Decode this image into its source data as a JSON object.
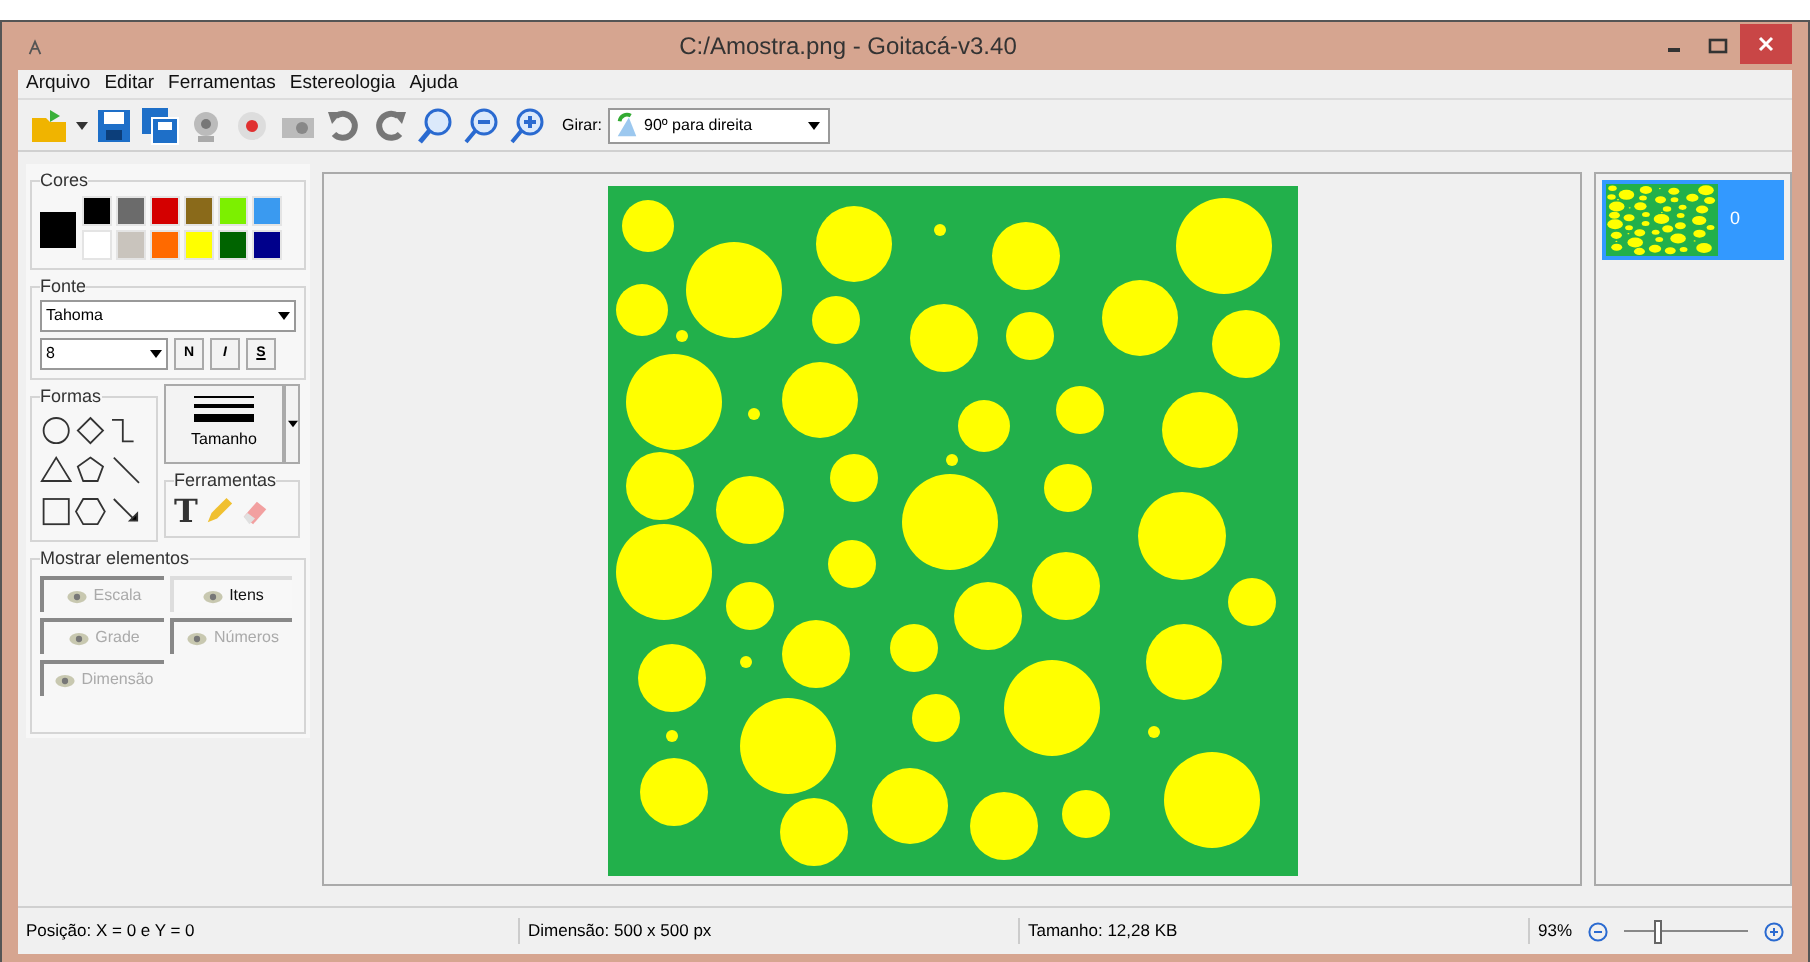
{
  "window": {
    "title": "C:/Amostra.png - Goitacá-v3.40"
  },
  "menu": [
    "Arquivo",
    "Editar",
    "Ferramentas",
    "Estereologia",
    "Ajuda"
  ],
  "toolbar": {
    "rotate_label": "Girar:",
    "rotate_value": "90º para direita"
  },
  "colors": {
    "title": "Cores",
    "current": {
      "color": "#000000"
    },
    "palette": [
      {
        "color": "#000000"
      },
      {
        "color": "#6b6b6b"
      },
      {
        "color": "#d40000"
      },
      {
        "color": "#8a6a1a"
      },
      {
        "color": "#7cf000"
      },
      {
        "color": "#3a9af0"
      },
      {
        "color": "#ffffff"
      },
      {
        "color": "#c9c4bd"
      },
      {
        "color": "#ff6a00"
      },
      {
        "color": "#ffff00"
      },
      {
        "color": "#006400"
      },
      {
        "color": "#00008b"
      }
    ]
  },
  "font": {
    "title": "Fonte",
    "family": "Tahoma",
    "size": "8",
    "styles": [
      "N",
      "I",
      "S"
    ]
  },
  "shapes": {
    "title": "Formas",
    "size_label": "Tamanho"
  },
  "tools": {
    "title": "Ferramentas",
    "items": [
      "T"
    ]
  },
  "show": {
    "title": "Mostrar elementos",
    "items": [
      {
        "label": "Escala",
        "on": false
      },
      {
        "label": "Itens",
        "on": true
      },
      {
        "label": "Grade",
        "on": false
      },
      {
        "label": "Números",
        "on": false
      },
      {
        "label": "Dimensão",
        "on": false
      }
    ]
  },
  "thumbnails": [
    {
      "label": "0",
      "selected": true
    }
  ],
  "status_bar": {
    "position": "Posição: X = 0 e Y = 0",
    "dimension": "Dimensão: 500 x 500 px",
    "size": "Tamanho: 12,28 KB",
    "zoom": "93%",
    "level": 0.25
  }
}
